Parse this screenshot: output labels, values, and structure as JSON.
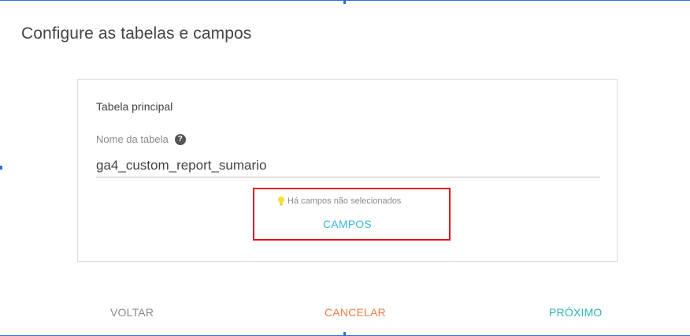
{
  "dialog": {
    "title": "Configure as tabelas e campos"
  },
  "card": {
    "heading": "Tabela principal",
    "field_label": "Nome da tabela",
    "help_glyph": "?",
    "table_name_value": "ga4_custom_report_sumario",
    "warning_text": "Há campos não selecionados",
    "fields_link": "CAMPOS"
  },
  "footer": {
    "back_label": "VOLTAR",
    "cancel_label": "CANCELAR",
    "next_label": "PRÓXIMO"
  },
  "icons": {
    "help": "question-circle-icon",
    "warning": "lightbulb-icon"
  },
  "colors": {
    "link": "#3ab6e0",
    "cancel": "#f07d4a",
    "next": "#2fb4b0",
    "highlight": "#e8111a",
    "bulb": "#f2e12e"
  }
}
